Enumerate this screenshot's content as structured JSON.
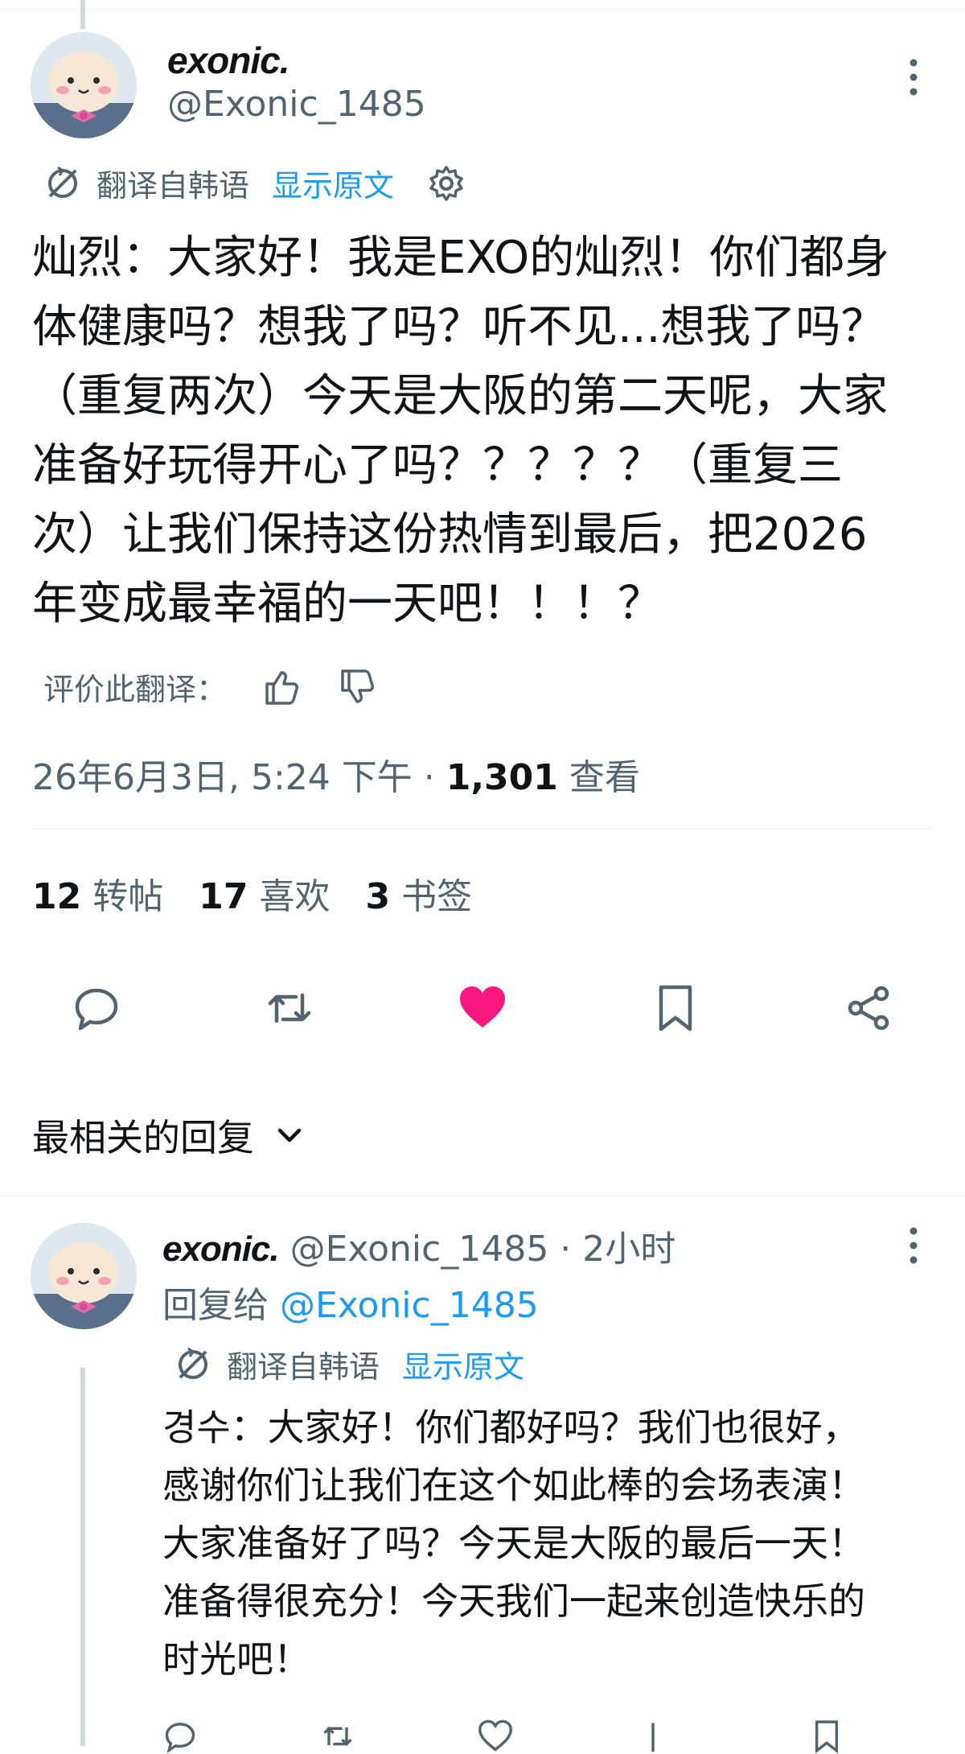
{
  "main_tweet": {
    "display_name": "exonic.",
    "handle": "@Exonic_1485",
    "translate": {
      "translated_label": "翻译自韩语",
      "show_original": "显示原文"
    },
    "text_lines": [
      "灿烈：大家好！我是EXO的灿烈！你们都身",
      "体健康吗？想我了吗？听不见...想我了吗？",
      "（重复两次）今天是大阪的第二天呢，大家",
      "准备好玩得开心了吗？？？？？（重复三",
      "次）让我们保持这份热情到最后，把2026",
      "年变成最幸福的一天吧！！！？"
    ],
    "rate_label": "评价此翻译：",
    "meta": {
      "datetime": "26年6月3日, 5:24 下午 · ",
      "views_count": "1,301",
      "views_label": " 查看"
    },
    "stats": {
      "reposts_count": "12",
      "reposts_label": "转帖",
      "likes_count": "17",
      "likes_label": "喜欢",
      "bookmarks_count": "3",
      "bookmarks_label": "书签"
    },
    "actions": {
      "like_color": "#f91880"
    }
  },
  "replies_sort": {
    "label": "最相关的回复"
  },
  "reply": {
    "display_name": "exonic.",
    "handle_time": "@Exonic_1485 · 2小时",
    "reply_to_label": "回复给 ",
    "reply_to_mention": "@Exonic_1485",
    "translate": {
      "translated_label": "翻译自韩语",
      "show_original": "显示原文"
    },
    "text_lines": [
      "경수：大家好！你们都好吗？我们也很好，",
      "感谢你们让我们在这个如此棒的会场表演！",
      "大家准备好了吗？今天是大阪的最后一天！",
      "准备得很充分！今天我们一起来创造快乐的",
      "时光吧！"
    ]
  },
  "colors": {
    "accent": "#1d9bf0",
    "secondary_text": "#536471",
    "primary_text": "#0f1419",
    "like": "#f91880"
  }
}
